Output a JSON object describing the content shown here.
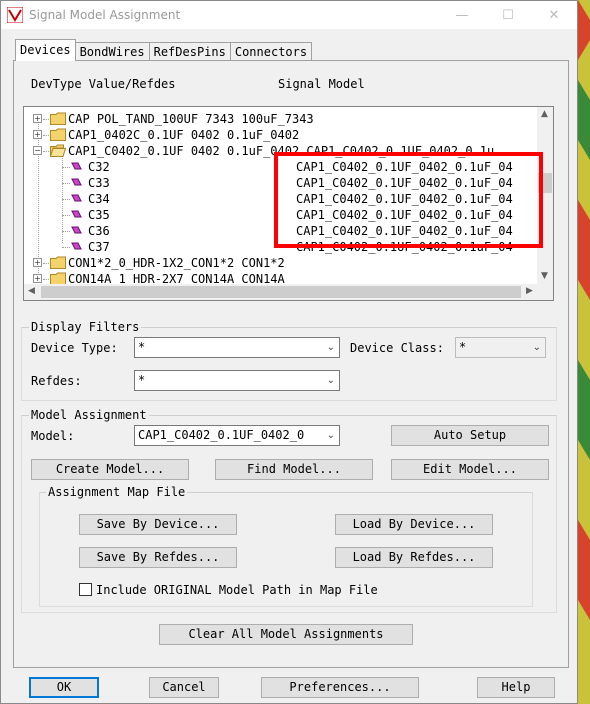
{
  "window": {
    "title": "Signal Model Assignment",
    "minimize": "—",
    "maximize": "☐",
    "close": "✕"
  },
  "tabs": [
    "Devices",
    "BondWires",
    "RefDesPins",
    "Connectors"
  ],
  "tree": {
    "col_devtype": "DevType Value/Refdes",
    "col_model": "Signal Model",
    "rows": [
      {
        "type": "folder",
        "expand": "+",
        "text": "CAP POL_TAND_100UF 7343 100uF_7343",
        "model": ""
      },
      {
        "type": "folder",
        "expand": "+",
        "text": "CAP1_0402C_0.1UF 0402 0.1uF_0402",
        "model": ""
      },
      {
        "type": "folder-open",
        "expand": "−",
        "text": "CAP1_C0402_0.1UF 0402 0.1uF_0402 CAP1_C0402_0.1UF_0402_0.1u",
        "model": ""
      },
      {
        "type": "leaf",
        "text": "C32",
        "model": "CAP1_C0402_0.1UF_0402_0.1uF_04"
      },
      {
        "type": "leaf",
        "text": "C33",
        "model": "CAP1_C0402_0.1UF_0402_0.1uF_04"
      },
      {
        "type": "leaf",
        "text": "C34",
        "model": "CAP1_C0402_0.1UF_0402_0.1uF_04"
      },
      {
        "type": "leaf",
        "text": "C35",
        "model": "CAP1_C0402_0.1UF_0402_0.1uF_04"
      },
      {
        "type": "leaf",
        "text": "C36",
        "model": "CAP1_C0402_0.1UF_0402_0.1uF_04"
      },
      {
        "type": "leaf",
        "text": "C37",
        "model": "CAP1_C0402_0.1UF_0402_0.1uF_04"
      },
      {
        "type": "folder",
        "expand": "+",
        "text": "CON1*2_0_HDR-1X2_CON1*2 CON1*2",
        "model": ""
      },
      {
        "type": "folder",
        "expand": "+",
        "text": "CON14A_1_HDR-2X7_CON14A CON14A",
        "model": ""
      }
    ],
    "scroll_up": "▲",
    "scroll_down": "▼",
    "scroll_left": "◀",
    "scroll_right": "▶"
  },
  "display_filters": {
    "title": "Display Filters",
    "device_type_label": "Device Type:",
    "device_type_value": "*",
    "device_class_label": "Device Class:",
    "device_class_value": "*",
    "refdes_label": "Refdes:",
    "refdes_value": "*"
  },
  "model_assignment": {
    "title": "Model Assignment",
    "model_label": "Model:",
    "model_value": "CAP1_C0402_0.1UF_0402_0",
    "auto_setup": "Auto Setup",
    "create_model": "Create Model...",
    "find_model": "Find Model...",
    "edit_model": "Edit Model..."
  },
  "map_file": {
    "title": "Assignment Map File",
    "save_by_device": "Save By Device...",
    "load_by_device": "Load By Device...",
    "save_by_refdes": "Save By Refdes...",
    "load_by_refdes": "Load By Refdes...",
    "include_label": "Include ORIGINAL Model Path in Map File"
  },
  "clear_all": "Clear All Model Assignments",
  "footer": {
    "ok": "OK",
    "cancel": "Cancel",
    "preferences": "Preferences...",
    "help": "Help"
  },
  "chevron": "⌄",
  "colors": {
    "highlight": "#ff0000",
    "folder": "#f5d36a",
    "leaf": "#cc44cc",
    "default_border": "#0078d7"
  }
}
